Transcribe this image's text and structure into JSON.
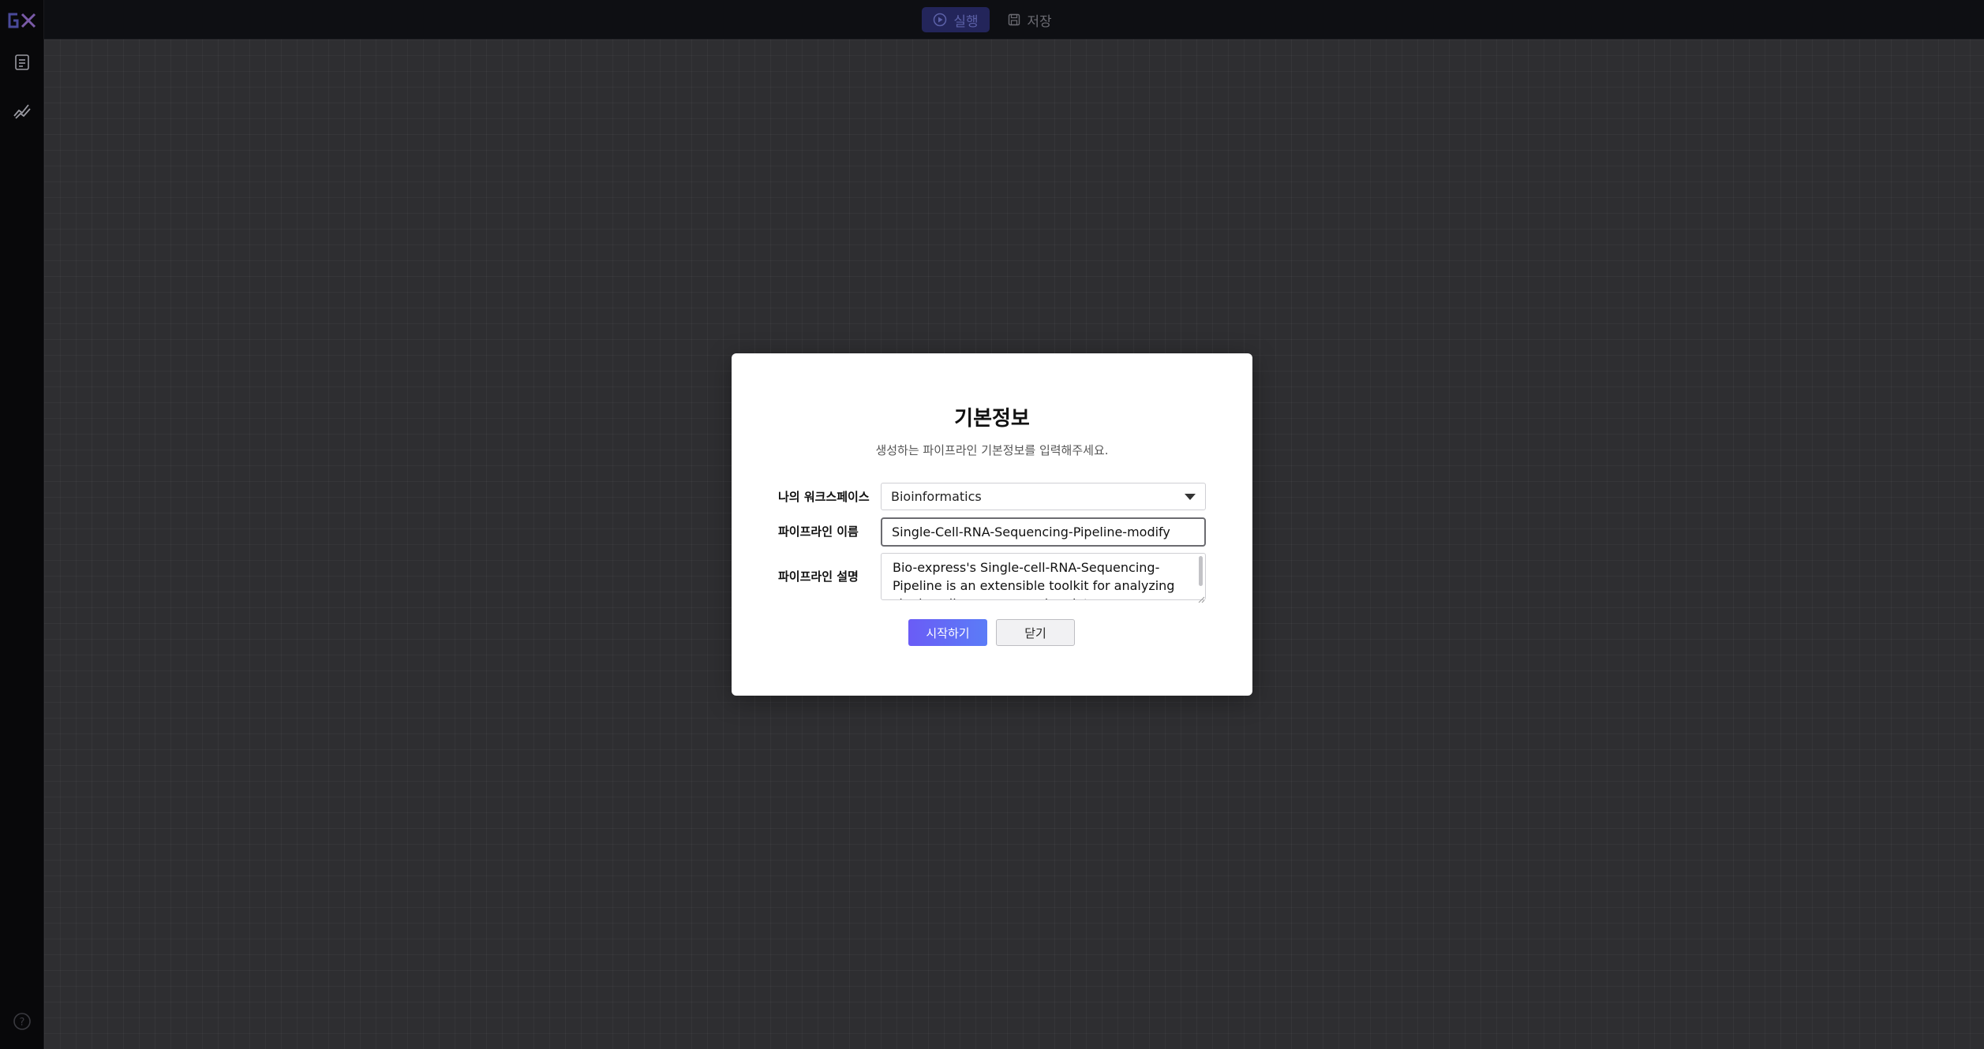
{
  "topbar": {
    "run_label": "실행",
    "save_label": "저장"
  },
  "sidebar": {
    "icons": [
      "logo-icon",
      "document-icon",
      "chart-icon",
      "help-icon"
    ]
  },
  "modal": {
    "title": "기본정보",
    "subtitle": "생성하는 파이프라인 기본정보를 입력해주세요.",
    "workspace_label": "나의 워크스페이스",
    "workspace_value": "Bioinformatics",
    "name_label": "파이프라인 이름",
    "name_value": "Single-Cell-RNA-Sequencing-Pipeline-modify",
    "description_label": "파이프라인 설명",
    "description_value": "Bio-express's Single-cell-RNA-Sequencing-Pipeline is an extensible toolkit for analyzing single-cell gene expression data",
    "start_label": "시작하기",
    "close_label": "닫기"
  },
  "colors": {
    "accent": "#6a5cf6",
    "canvas": "#2e2e31",
    "topbar": "#0e0f13"
  }
}
